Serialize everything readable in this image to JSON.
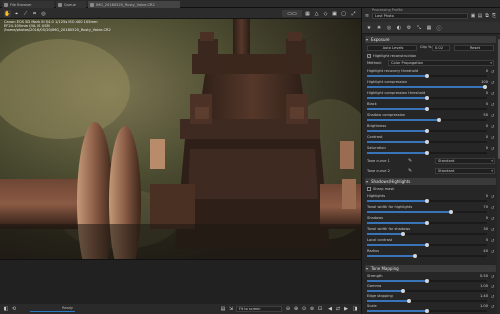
{
  "tabs": [
    {
      "label": "File Browser",
      "active": false
    },
    {
      "label": "Queue",
      "active": false
    },
    {
      "label": "IMG_20180520_Rusty_Valve.CR2",
      "active": true
    }
  ],
  "image_info": [
    "Canon EOS 5D Mark III  f/4.0  1/125s  ISO 400  105mm",
    "EF24-105mm f/4L IS USM",
    "/home/photos/2018/05/20/IMG_20180520_Rusty_Valve.CR2"
  ],
  "bottom": {
    "progress_label": "Ready",
    "progress_fraction": 0.6,
    "zoom_value": "Fit to screen"
  },
  "panel": {
    "history_header": "Processing Profile",
    "profile_value": "Last Photo",
    "exposure_section": "Exposure",
    "tone": {
      "auto_levels": "Auto Levels",
      "clip_label": "Clip %:",
      "clip_value": "0.02",
      "reset": "Reset"
    },
    "highlight_reconstruction": "Highlight reconstruction",
    "method_label": "Method:",
    "method_value": "Color Propagation",
    "sliders1": [
      {
        "label": "Highlight recovery threshold",
        "value": "0"
      },
      {
        "label": "Highlight compression",
        "value": "100"
      },
      {
        "label": "Highlight compression threshold",
        "value": "0"
      },
      {
        "label": "Black",
        "value": "0"
      },
      {
        "label": "Shadow compression",
        "value": "50"
      },
      {
        "label": "Brightness",
        "value": "0"
      },
      {
        "label": "Contrast",
        "value": "0"
      },
      {
        "label": "Saturation",
        "value": "0"
      }
    ],
    "tone_curves": [
      {
        "label": "Tone curve 1",
        "mode": "Standard"
      },
      {
        "label": "Tone curve 2",
        "mode": "Standard"
      }
    ],
    "sh_section": "Shadows/Highlights",
    "sh_checkbox": "Sharp mask",
    "sliders2": [
      {
        "label": "Highlights",
        "value": "0"
      },
      {
        "label": "Tonal width for highlights",
        "value": "70"
      },
      {
        "label": "Shadows",
        "value": "0"
      },
      {
        "label": "Tonal width for shadows",
        "value": "30"
      },
      {
        "label": "Local contrast",
        "value": "0"
      },
      {
        "label": "Radius",
        "value": "40"
      }
    ],
    "tm_section": "Tone Mapping",
    "sliders3": [
      {
        "label": "Strength",
        "value": "0.50"
      },
      {
        "label": "Gamma",
        "value": "1.00"
      },
      {
        "label": "Edge stopping",
        "value": "1.40"
      },
      {
        "label": "Scale",
        "value": "1.00"
      }
    ]
  },
  "colors": {
    "accent": "#3a74b8"
  }
}
